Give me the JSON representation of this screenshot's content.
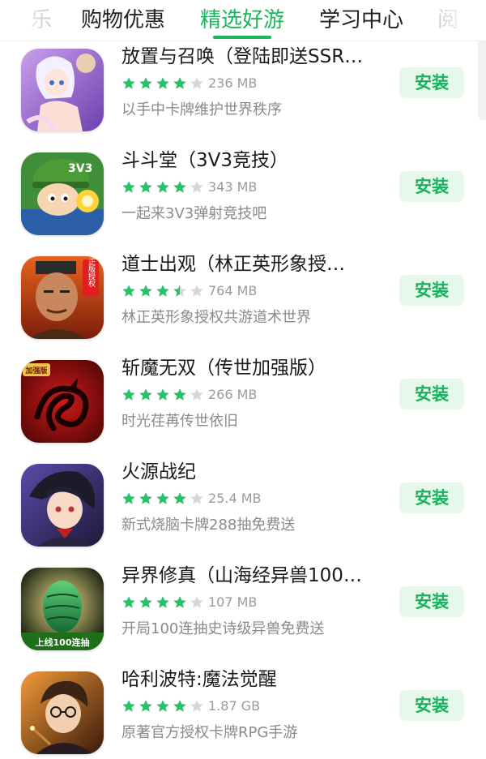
{
  "tabs": [
    {
      "label": "乐",
      "state": "faded"
    },
    {
      "label": "购物优惠",
      "state": "normal"
    },
    {
      "label": "精选好游",
      "state": "active"
    },
    {
      "label": "学习中心",
      "state": "normal"
    },
    {
      "label": "阅",
      "state": "faded"
    }
  ],
  "colors": {
    "accent": "#19b75c",
    "install_bg": "#e6f7ec",
    "star_filled": "#2bbf6a",
    "star_empty": "#d8d8d8"
  },
  "install_label": "安装",
  "apps": [
    {
      "name": "放置与召唤（登陆即送SSR…",
      "rating": 4,
      "size": "236 MB",
      "desc": "以手中卡牌维护世界秩序",
      "icon": "anime-girl-icon"
    },
    {
      "name": "斗斗堂（3V3竞技）",
      "rating": 4,
      "size": "343 MB",
      "desc": "一起来3V3弹射竞技吧",
      "icon": "soldier-helmet-icon"
    },
    {
      "name": "道士出观（林正英形象授…",
      "rating": 3.5,
      "size": "764 MB",
      "desc": "林正英形象授权共游道术世界",
      "icon": "taoist-priest-icon"
    },
    {
      "name": "斩魔无双（传世加强版）",
      "rating": 4,
      "size": "266 MB",
      "desc": "时光荏苒传世依旧",
      "icon": "red-dragon-icon"
    },
    {
      "name": "火源战纪",
      "rating": 4,
      "size": "25.4 MB",
      "desc": "新式烧脑卡牌288抽免费送",
      "icon": "dark-hair-hero-icon"
    },
    {
      "name": "异界修真（山海经异兽100…",
      "rating": 4,
      "size": "107 MB",
      "desc": "开局100连抽史诗级异兽免费送",
      "icon": "green-dragon-egg-icon"
    },
    {
      "name": "哈利波特:魔法觉醒",
      "rating": 4,
      "size": "1.87 GB",
      "desc": "原著官方授权卡牌RPG手游",
      "icon": "wizard-boy-icon"
    }
  ],
  "icon_badges": {
    "soldier": "3V3",
    "taoist": "正版授权",
    "dragon": "加强版",
    "egg": "上线100连抽"
  }
}
